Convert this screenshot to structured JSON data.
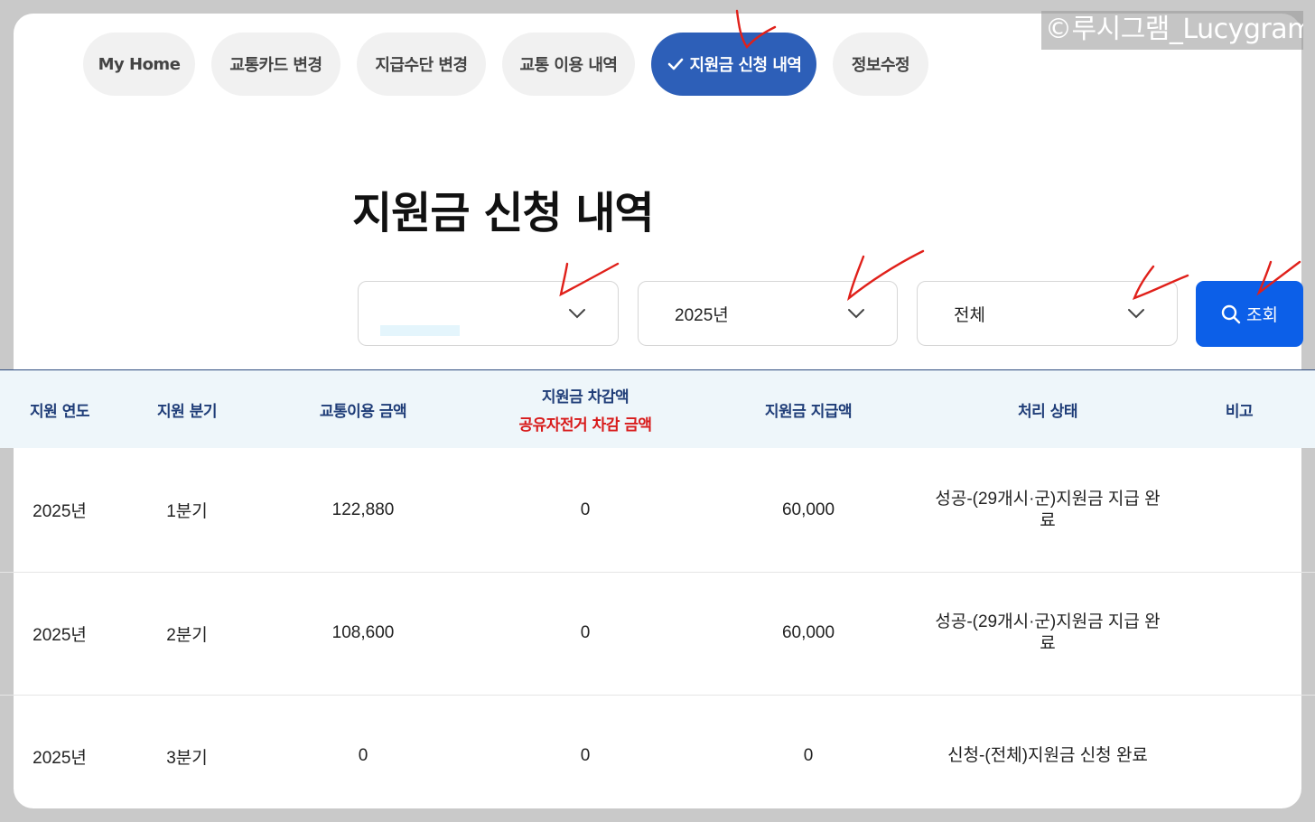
{
  "watermark": "©루시그램_Lucygram",
  "tabs": [
    {
      "label": "My Home",
      "active": false
    },
    {
      "label": "교통카드 변경",
      "active": false
    },
    {
      "label": "지급수단 변경",
      "active": false
    },
    {
      "label": "교통 이용 내역",
      "active": false
    },
    {
      "label": "지원금 신청 내역",
      "active": true
    },
    {
      "label": "정보수정",
      "active": false
    }
  ],
  "page_title": "지원금 신청 내역",
  "filters": {
    "select1_value": "",
    "year_value": "2025년",
    "status_value": "전체",
    "search_label": "조회"
  },
  "table": {
    "headers": {
      "year": "지원 연도",
      "quarter": "지원 분기",
      "usage": "교통이용 금액",
      "deduction": "지원금 차감액",
      "deduction_sub": "공유자전거 차감 금액",
      "payment": "지원금 지급액",
      "status": "처리 상태",
      "note": "비고"
    },
    "rows": [
      {
        "year": "2025년",
        "quarter": "1분기",
        "usage": "122,880",
        "deduction": "0",
        "payment": "60,000",
        "status": "성공-(29개시·군)지원금 지급 완료",
        "note": ""
      },
      {
        "year": "2025년",
        "quarter": "2분기",
        "usage": "108,600",
        "deduction": "0",
        "payment": "60,000",
        "status": "성공-(29개시·군)지원금 지급 완료",
        "note": ""
      },
      {
        "year": "2025년",
        "quarter": "3분기",
        "usage": "0",
        "deduction": "0",
        "payment": "0",
        "status": "신청-(전체)지원금 신청 완료",
        "note": ""
      }
    ]
  },
  "colors": {
    "active_tab": "#2d5fb8",
    "search_button": "#0c5fe8",
    "header_text": "#1f3d78",
    "header_sub_text": "#d81a1a",
    "annotation": "#e0201a"
  }
}
